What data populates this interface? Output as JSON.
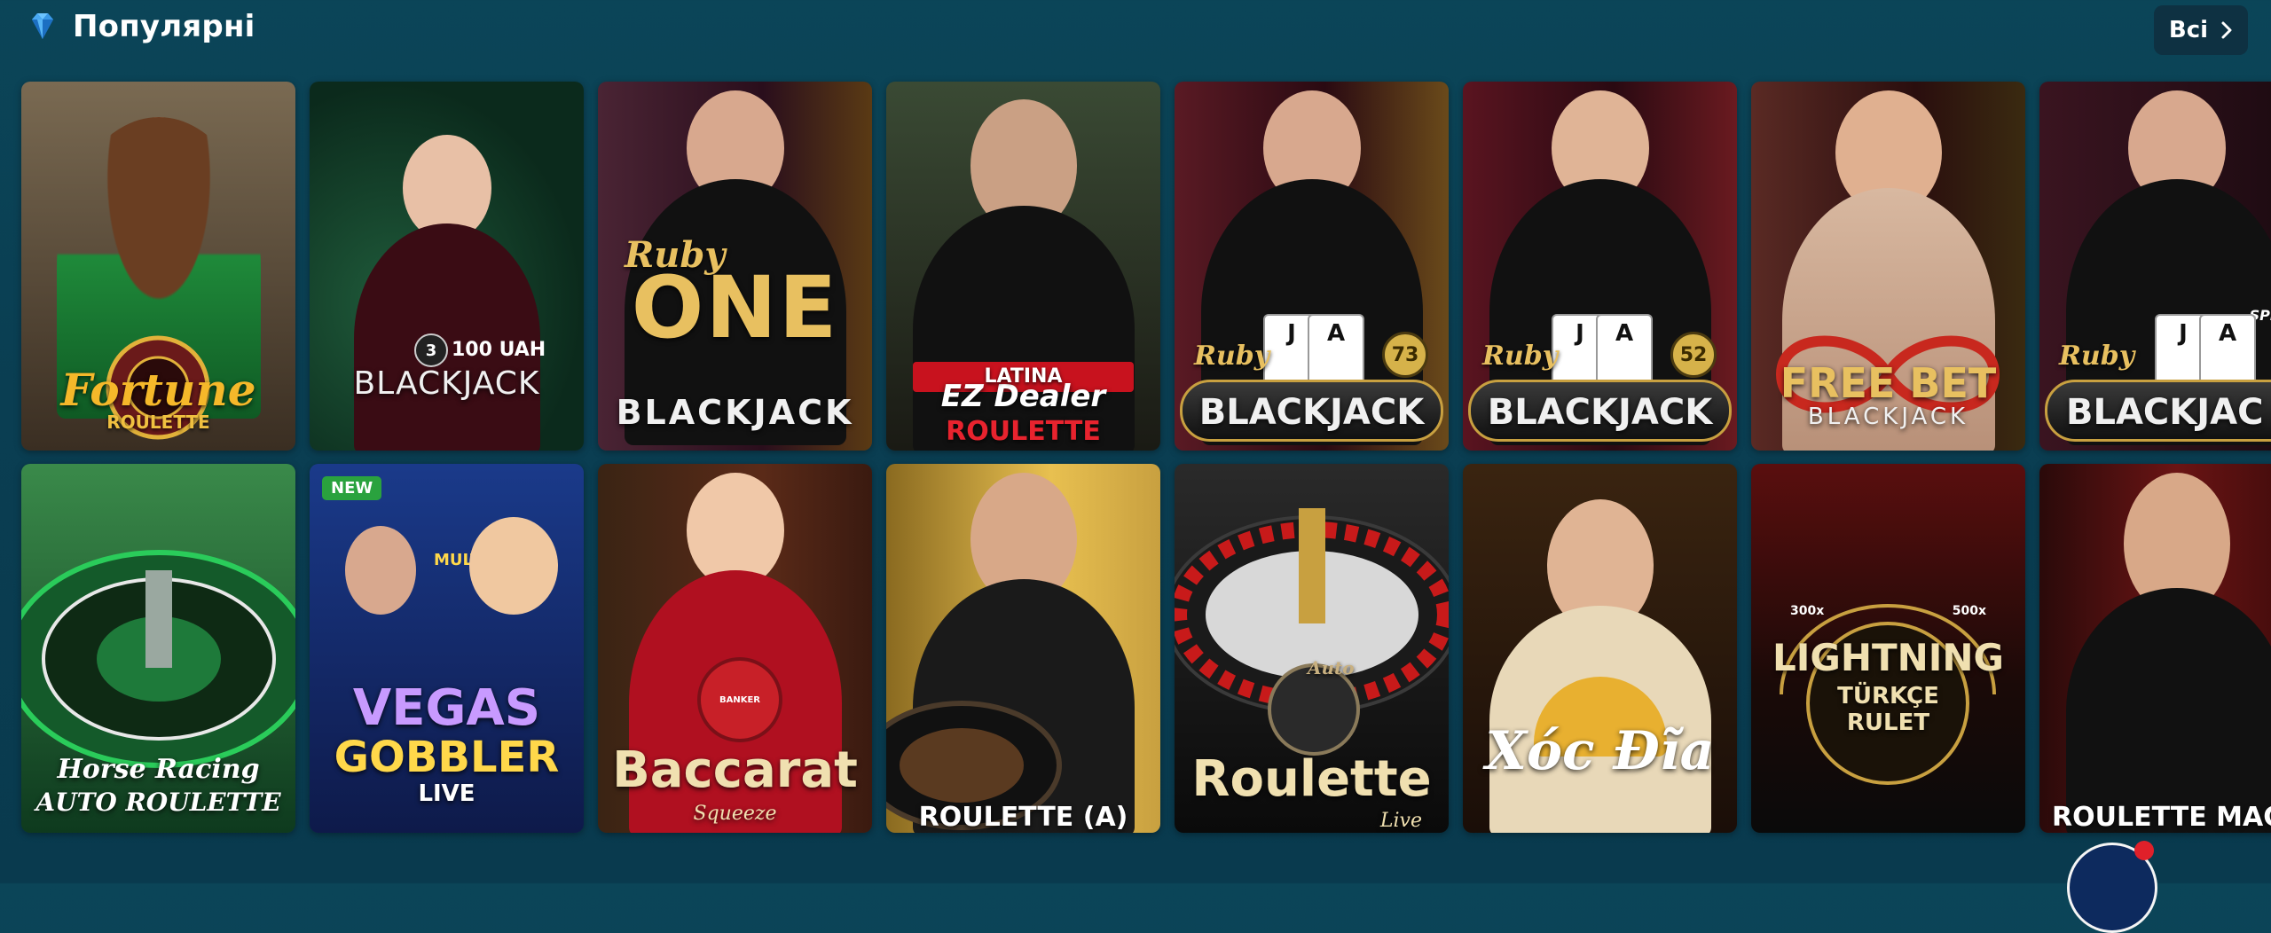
{
  "header": {
    "title": "Популярні",
    "icon": "diamond-icon",
    "all_button_label": "Всі",
    "all_button_icon": "chevron-right-icon"
  },
  "games": [
    {
      "title_line1": "Fortune",
      "title_line2": "ROULETTE",
      "bg": "#6b5a44"
    },
    {
      "title_line1": "100 UAH",
      "title_line2": "BLACKJACK",
      "badge_number": "3",
      "bg": "#163a2a"
    },
    {
      "title_line1": "Ruby",
      "title_line2": "ONE",
      "title_line3": "BLACKJACK",
      "bg": "#3a1e2a"
    },
    {
      "title_line1": "LATINA",
      "title_line2": "EZ Dealer",
      "title_line3": "ROULETTE",
      "bg": "#3a3a2a"
    },
    {
      "title_line1": "Ruby",
      "title_line2": "BLACKJACK",
      "table_number": "73",
      "bg": "#4a1c24"
    },
    {
      "title_line1": "Ruby",
      "title_line2": "BLACKJACK",
      "table_number": "52",
      "bg": "#4a1c24"
    },
    {
      "title_line1": "FREE BET",
      "title_line2": "BLACKJACK",
      "bg": "#4a2426"
    },
    {
      "title_line1": "Ruby",
      "title_line2": "BLACKJAC",
      "speed_text": "SPEED",
      "bg": "#3c1a24"
    },
    {
      "title_line1": "Horse Racing",
      "title_line2": "AUTO ROULETTE",
      "bg": "#1f5a2e"
    },
    {
      "title_line1": "VEGAS",
      "title_line2": "GOBBLER",
      "title_line3": "LIVE",
      "badge": "NEW",
      "sign_text": "MULTI",
      "bg": "#1a2a6a"
    },
    {
      "title_line1": "Baccarat",
      "title_line2": "Squeeze",
      "chip_text": "BANKER",
      "bg": "#4a2418"
    },
    {
      "title_line1": "ROULETTE (A)",
      "bg": "#c8a040"
    },
    {
      "title_line1": "Auto",
      "title_line2": "Roulette",
      "title_line3": "Live",
      "bg": "#202020"
    },
    {
      "title_line1": "Xóc Đĩa",
      "bg": "#2a1a10"
    },
    {
      "title_line1": "LIGHTNING",
      "title_line2": "TÜRKÇE",
      "title_line3": "RULET",
      "mult_left": "300x",
      "mult_right": "500x",
      "bg": "#1a0e0a"
    },
    {
      "title_line1": "ROULETTE MAC",
      "bg": "#3a0e10"
    }
  ]
}
